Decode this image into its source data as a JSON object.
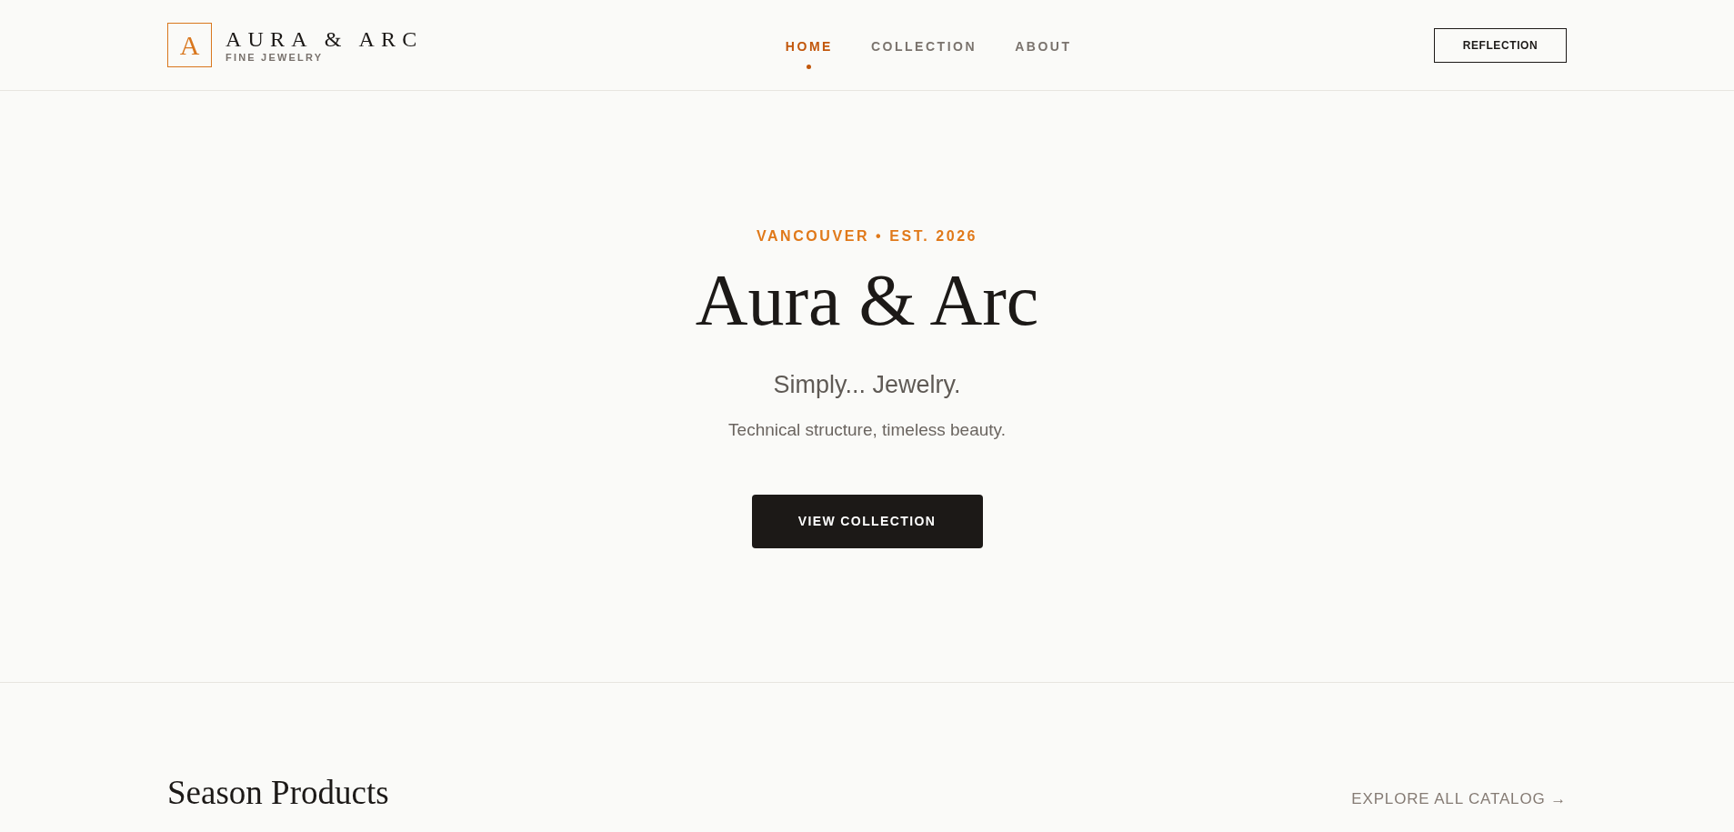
{
  "header": {
    "logo": {
      "letter": "A",
      "name": "AURA & ARC",
      "tagline": "FINE JEWELRY"
    },
    "nav": [
      {
        "label": "HOME",
        "selected": true
      },
      {
        "label": "COLLECTION",
        "selected": false
      },
      {
        "label": "ABOUT",
        "selected": false
      }
    ],
    "button": "REFLECTION"
  },
  "hero": {
    "eyebrow": "VANCOUVER • EST. 2026",
    "title": "Aura & Arc",
    "subtitle": "Simply... Jewelry.",
    "tagline": "Technical structure, timeless beauty.",
    "cta": "VIEW COLLECTION"
  },
  "section": {
    "title": "Season Products",
    "link": "EXPLORE ALL CATALOG →"
  }
}
